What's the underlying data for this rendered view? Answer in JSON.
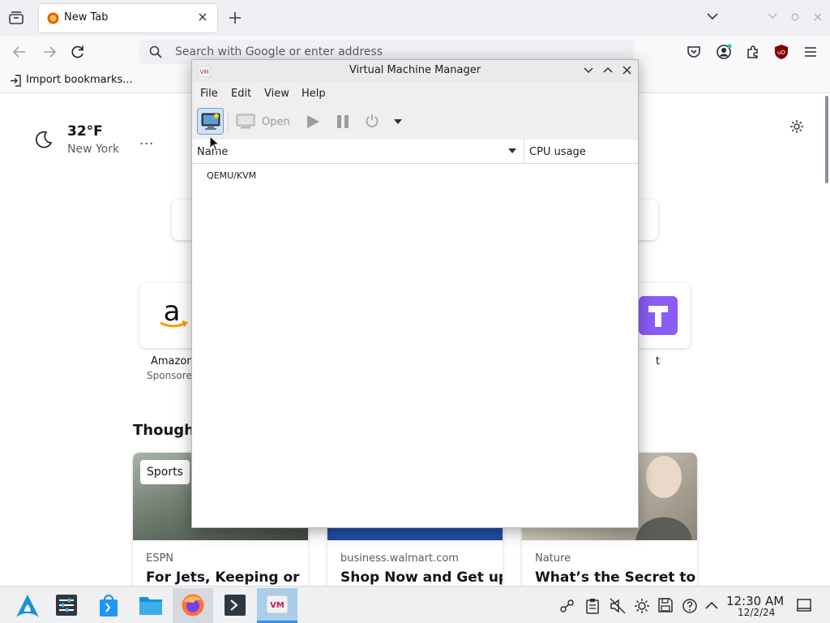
{
  "browser": {
    "tab_title": "New Tab",
    "url_placeholder": "Search with Google or enter address",
    "bookmark_label": "Import bookmarks..."
  },
  "newtab": {
    "weather": {
      "temp": "32°F",
      "city": "New York"
    },
    "more_label": "...",
    "shortcuts": [
      {
        "label": "Amazon",
        "sub": "Sponsored",
        "icon": "amazon-logo"
      },
      {
        "label": "t",
        "icon": "t-logo"
      }
    ],
    "section_title": "Thought",
    "cards": [
      {
        "badge": "Sports",
        "source": "ESPN",
        "headline": "For Jets, Keeping or"
      },
      {
        "source": "business.walmart.com",
        "headline": "Shop Now and Get up"
      },
      {
        "source": "Nature",
        "headline": "What’s the Secret to"
      }
    ]
  },
  "vmm": {
    "title": "Virtual Machine Manager",
    "menu": [
      "File",
      "Edit",
      "View",
      "Help"
    ],
    "toolbar": {
      "open_label": "Open"
    },
    "columns": {
      "name": "Name",
      "cpu": "CPU usage"
    },
    "connections": [
      "QEMU/KVM"
    ]
  },
  "taskbar": {
    "apps": [
      "start-menu",
      "system-settings",
      "discover",
      "file-manager",
      "firefox",
      "terminal",
      "virt-manager"
    ],
    "clock": {
      "time": "12:30 AM",
      "date": "12/2/24"
    }
  },
  "colors": {
    "vmm_selected_toolbar": "#cfe3f4",
    "taskbar_active": "#a9cdeb",
    "amazon_orange": "#ff9900",
    "t_tile_purple": "#8b5cf6"
  }
}
